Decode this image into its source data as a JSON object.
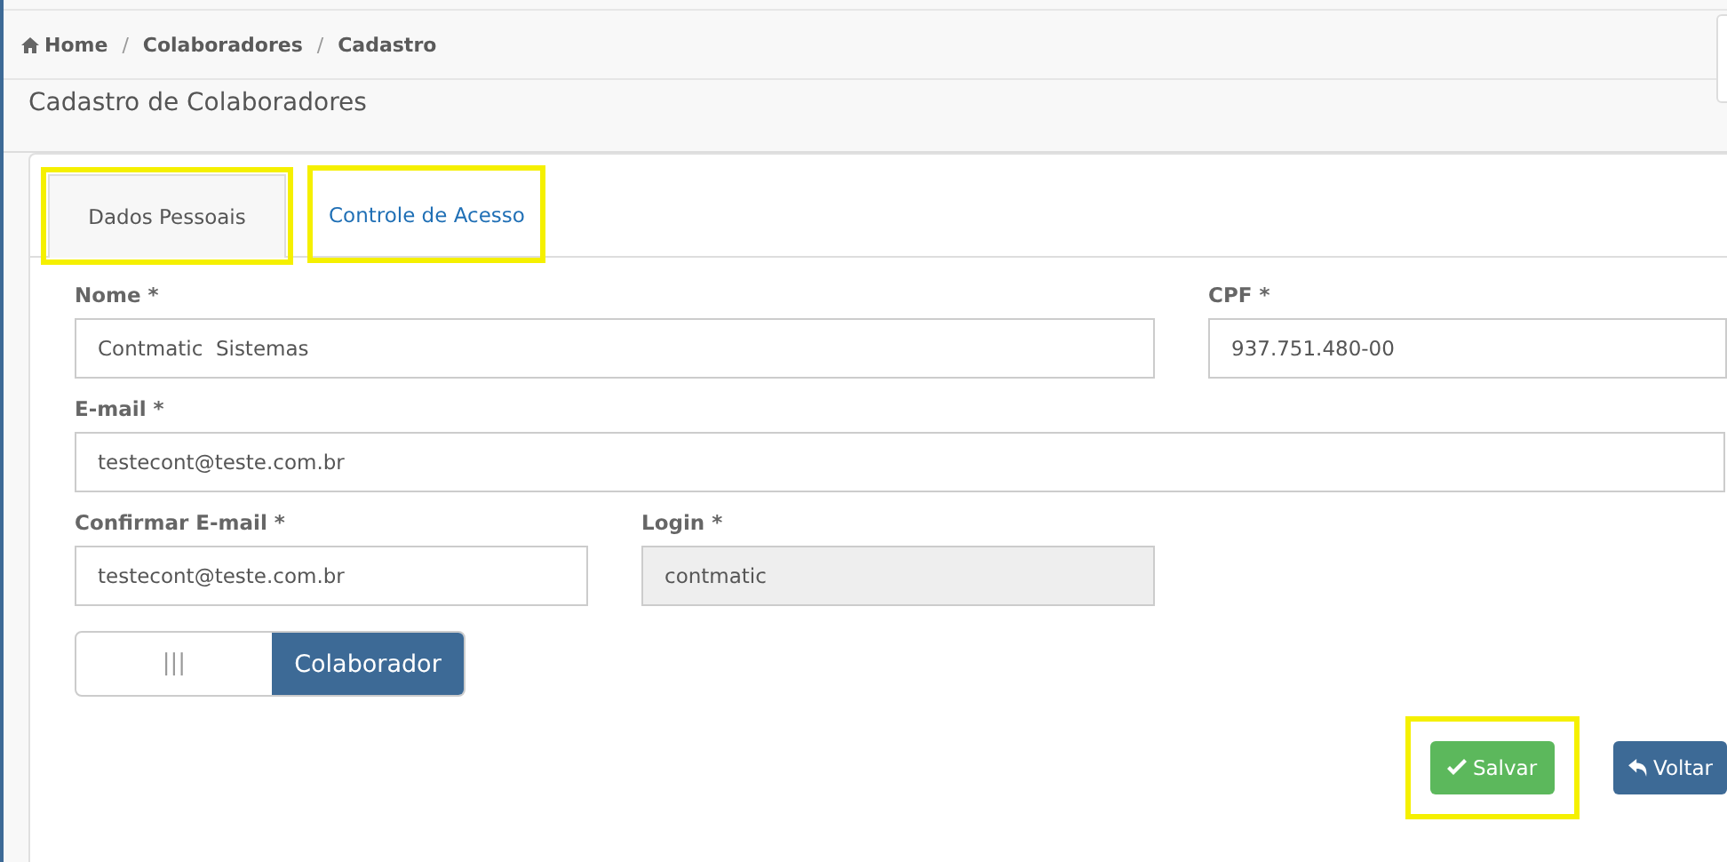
{
  "breadcrumb": {
    "separator": "/",
    "items": [
      {
        "label": "Home"
      },
      {
        "label": "Colaboradores"
      },
      {
        "label": "Cadastro"
      }
    ]
  },
  "page_title": "Cadastro de Colaboradores",
  "tabs": [
    {
      "label": "Dados Pessoais",
      "selected": true,
      "highlighted": true
    },
    {
      "label": "Controle de Acesso",
      "selected": false,
      "highlighted": true
    }
  ],
  "fields": [
    {
      "label": "Nome *",
      "value": "Contmatic  Sistemas",
      "disabled": false
    },
    {
      "label": "CPF *",
      "value": "937.751.480-00",
      "disabled": false
    },
    {
      "label": "E-mail *",
      "value": "testecont@teste.com.br",
      "disabled": false
    },
    {
      "label": "Confirmar E-mail *",
      "value": "testecont@teste.com.br",
      "disabled": false
    },
    {
      "label": "Login *",
      "value": "contmatic",
      "disabled": true
    }
  ],
  "switch": {
    "off_label": "|||",
    "on_label": "Colaborador",
    "on": true
  },
  "buttons": [
    {
      "label": "Salvar",
      "kind": "save",
      "highlighted": true
    },
    {
      "label": "Voltar",
      "kind": "back",
      "highlighted": false
    }
  ]
}
